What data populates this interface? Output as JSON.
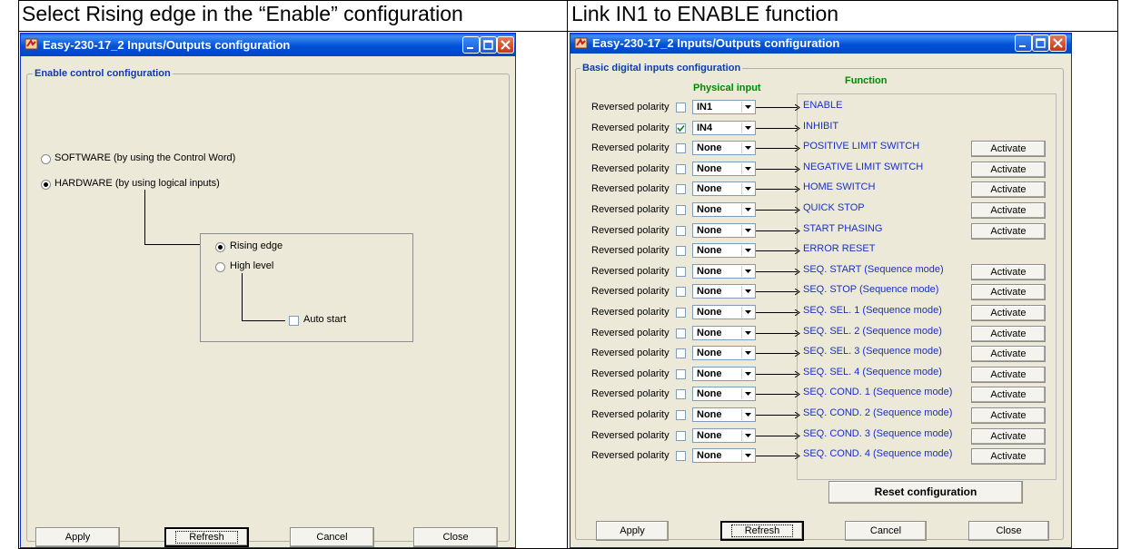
{
  "captions": {
    "left": "Select Rising edge in the “Enable” configuration",
    "right": "Link IN1 to ENABLE function"
  },
  "left_window": {
    "title": "Easy-230-17_2 Inputs/Outputs configuration",
    "group_label": "Enable control configuration",
    "radio_software": "SOFTWARE (by using the Control Word)",
    "radio_hardware": "HARDWARE (by using logical inputs)",
    "radio_rising": "Rising edge",
    "radio_high": "High level",
    "auto_start": "Auto start",
    "buttons": {
      "apply": "Apply",
      "refresh": "Refresh",
      "cancel": "Cancel",
      "close": "Close"
    }
  },
  "right_window": {
    "title": "Easy-230-17_2 Inputs/Outputs configuration",
    "group_label": "Basic digital inputs configuration",
    "col_physical": "Physical input",
    "col_function": "Function",
    "rows": [
      {
        "polarity": "Reversed polarity",
        "checked": false,
        "input": "IN1",
        "function": "ENABLE",
        "activate": ""
      },
      {
        "polarity": "Reversed polarity",
        "checked": true,
        "input": "IN4",
        "function": "INHIBIT",
        "activate": ""
      },
      {
        "polarity": "Reversed polarity",
        "checked": false,
        "input": "None",
        "function": "POSITIVE LIMIT SWITCH",
        "activate": "Activate"
      },
      {
        "polarity": "Reversed polarity",
        "checked": false,
        "input": "None",
        "function": "NEGATIVE LIMIT SWITCH",
        "activate": "Activate"
      },
      {
        "polarity": "Reversed polarity",
        "checked": false,
        "input": "None",
        "function": "HOME SWITCH",
        "activate": "Activate"
      },
      {
        "polarity": "Reversed polarity",
        "checked": false,
        "input": "None",
        "function": "QUICK STOP",
        "activate": "Activate"
      },
      {
        "polarity": "Reversed polarity",
        "checked": false,
        "input": "None",
        "function": "START PHASING",
        "activate": "Activate"
      },
      {
        "polarity": "Reversed polarity",
        "checked": false,
        "input": "None",
        "function": "ERROR RESET",
        "activate": ""
      },
      {
        "polarity": "Reversed polarity",
        "checked": false,
        "input": "None",
        "function": "SEQ. START (Sequence mode)",
        "activate": "Activate"
      },
      {
        "polarity": "Reversed polarity",
        "checked": false,
        "input": "None",
        "function": "SEQ. STOP (Sequence mode)",
        "activate": "Activate"
      },
      {
        "polarity": "Reversed polarity",
        "checked": false,
        "input": "None",
        "function": "SEQ. SEL. 1 (Sequence mode)",
        "activate": "Activate"
      },
      {
        "polarity": "Reversed polarity",
        "checked": false,
        "input": "None",
        "function": "SEQ. SEL. 2 (Sequence mode)",
        "activate": "Activate"
      },
      {
        "polarity": "Reversed polarity",
        "checked": false,
        "input": "None",
        "function": "SEQ. SEL. 3 (Sequence mode)",
        "activate": "Activate"
      },
      {
        "polarity": "Reversed polarity",
        "checked": false,
        "input": "None",
        "function": "SEQ. SEL. 4 (Sequence mode)",
        "activate": "Activate"
      },
      {
        "polarity": "Reversed polarity",
        "checked": false,
        "input": "None",
        "function": "SEQ. COND. 1 (Sequence mode)",
        "activate": "Activate"
      },
      {
        "polarity": "Reversed polarity",
        "checked": false,
        "input": "None",
        "function": "SEQ. COND. 2 (Sequence mode)",
        "activate": "Activate"
      },
      {
        "polarity": "Reversed polarity",
        "checked": false,
        "input": "None",
        "function": "SEQ. COND. 3 (Sequence mode)",
        "activate": "Activate"
      },
      {
        "polarity": "Reversed polarity",
        "checked": false,
        "input": "None",
        "function": "SEQ. COND. 4 (Sequence mode)",
        "activate": "Activate"
      }
    ],
    "reset_label": "Reset configuration",
    "buttons": {
      "apply": "Apply",
      "refresh": "Refresh",
      "cancel": "Cancel",
      "close": "Close"
    }
  },
  "icons": {
    "app": "app-icon",
    "minimize": "minimize-icon",
    "maximize": "maximize-icon",
    "close": "close-icon",
    "dropdown": "chevron-down-icon"
  },
  "colors": {
    "titlebar": "#0052d6",
    "group_label": "#0e3bb1",
    "function_text": "#1a2fc9",
    "physical_header": "#008a00",
    "dialog_bg": "#ece9d8"
  }
}
